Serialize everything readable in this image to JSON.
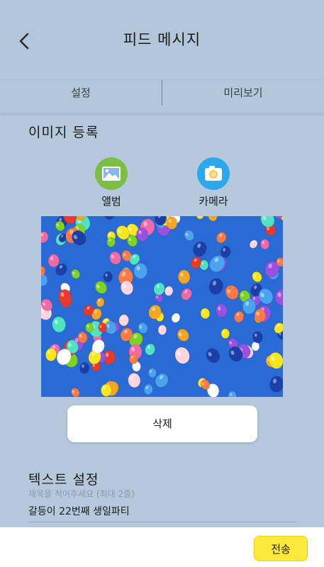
{
  "header": {
    "title": "피드 메시지"
  },
  "tabs": [
    {
      "label": "설정"
    },
    {
      "label": "미리보기"
    }
  ],
  "image_section": {
    "title": "이미지 등록",
    "album_label": "앨범",
    "camera_label": "카메라",
    "delete_label": "삭제"
  },
  "text_section": {
    "title": "텍스트 설정",
    "hint": "제목을 적어주세요 (최대 2줄)",
    "value": "갈등이 22번째 생일파티"
  },
  "bottom_bar": {
    "send_label": "전송"
  },
  "colors": {
    "background": "#b5c8dc",
    "album_icon_bg": "#7bbd45",
    "camera_icon_bg": "#2ea8ec",
    "photo_sky": "#2a6ad4",
    "send_button": "#fde93b"
  }
}
